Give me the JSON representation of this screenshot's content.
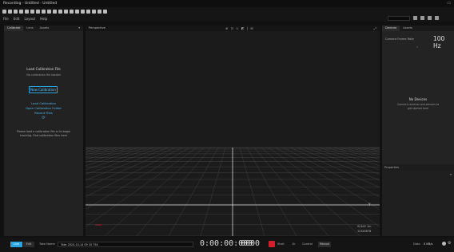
{
  "window": {
    "title": "Recording - Untitled - Untitled",
    "win_controls": "▭"
  },
  "menu": [
    "File",
    "Edit",
    "Layout",
    "Help"
  ],
  "left_panel": {
    "tabs": [
      "Calibrate",
      "Lens",
      "Assets"
    ],
    "heading": "Load Calibration File",
    "subheading": "No calibration file loaded",
    "new_button": "New Calibration",
    "load_link": "Load Calibration",
    "open_link": "Open Calibration Folder",
    "recent_link": "Recent Files",
    "hint_line1": "Please load a calibration file or to begin",
    "hint_line2": "tracking. Find calibration files here"
  },
  "viewport": {
    "label": "Perspective",
    "controls": "⊕  ⊡  ◇  ◩  |  ⊞",
    "corner_label_top": "SCALE 1m",
    "corner_label_bottom": "12345678",
    "axis_label": "Y"
  },
  "right_panel": {
    "tabs": [
      "Devices",
      "Assets"
    ],
    "fps_label": "Camera Frame Rate",
    "fps_value": "100 Hz",
    "empty_title": "No Devices",
    "empty_desc1": "Connect cameras and sensors to",
    "empty_desc2": "get started here",
    "properties_title": "Properties"
  },
  "bottom": {
    "live": "Live",
    "edit": "Edit",
    "take_label": "Take Name",
    "take_value": "Take 2024-10-14 09 33 754",
    "timecode": "0:00:00:000",
    "frame": "0000",
    "rec_state": "Start",
    "count": "1k",
    "control": "Control",
    "mode": "Manual",
    "data_label": "Data",
    "data_value": "0 KB/s"
  },
  "colors": {
    "accent": "#2aa4e0",
    "record": "#d11f2b",
    "bg": "#1b1b1b"
  }
}
